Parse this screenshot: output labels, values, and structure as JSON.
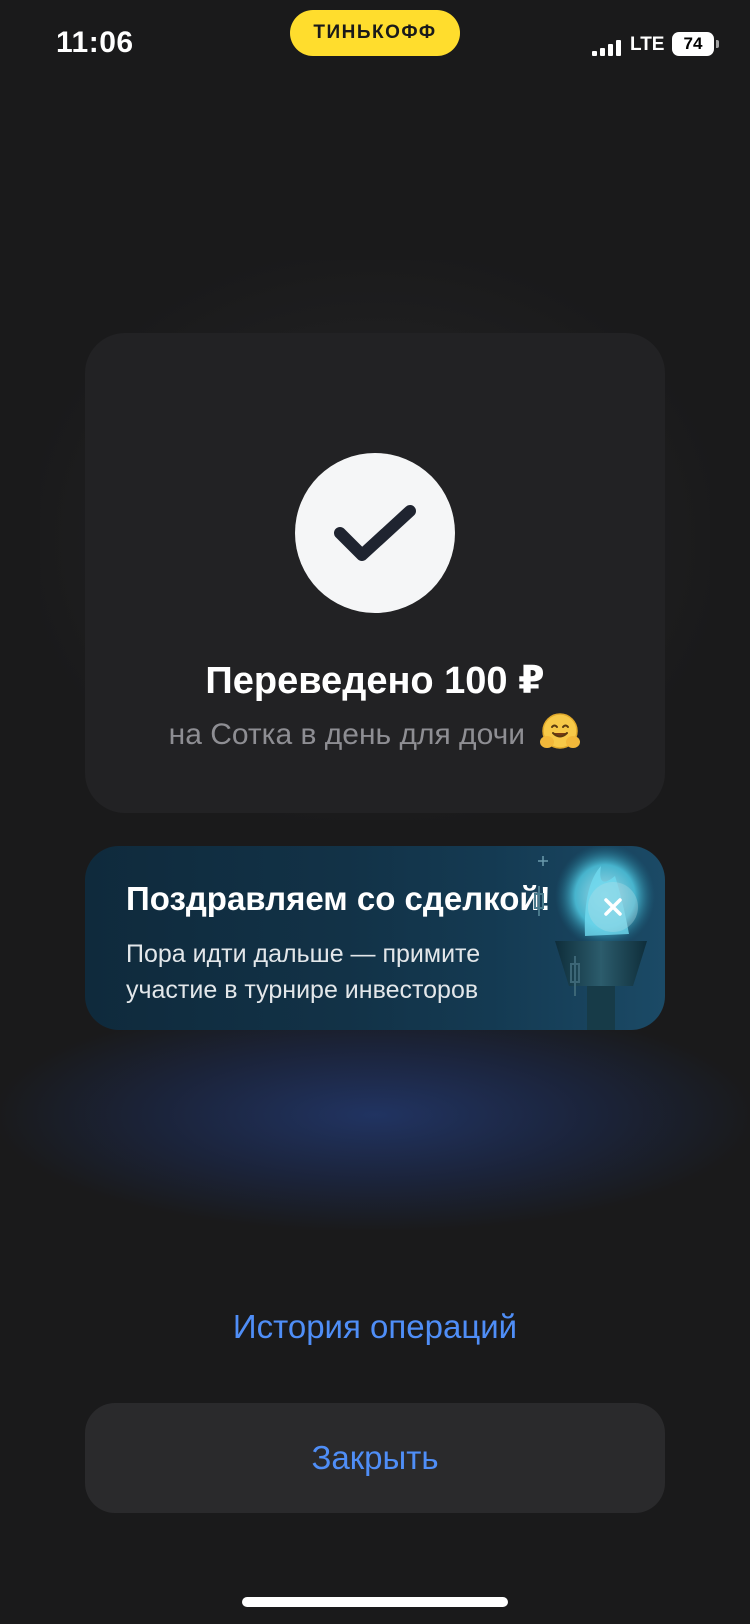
{
  "status_bar": {
    "time": "11:06",
    "brand": "ТИНЬКОФФ",
    "network": "LTE",
    "battery": "74"
  },
  "success": {
    "icon": "checkmark-icon",
    "title": "Переведено 100 ₽",
    "subtitle": "на Сотка в день для дочи",
    "emoji": "hugging-face-emoji"
  },
  "promo": {
    "title": "Поздравляем со сделкой!",
    "text": "Пора идти дальше — примите участие в турнире инвесторов",
    "art": "torch-icon",
    "close_icon": "close-icon"
  },
  "actions": {
    "history_label": "История операций",
    "close_label": "Закрыть"
  },
  "colors": {
    "background": "#1a1a1b",
    "card": "#222224",
    "brand_yellow": "#ffdd2d",
    "link_blue": "#4f8ef7"
  }
}
